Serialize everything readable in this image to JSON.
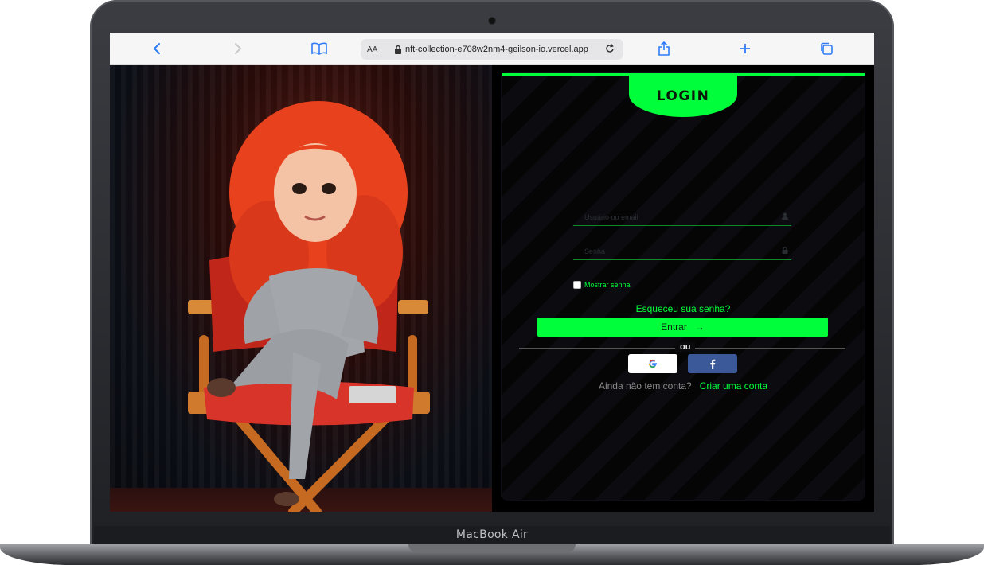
{
  "device": {
    "label": "MacBook Air"
  },
  "browser": {
    "text_size_label": "AA",
    "url": "nft-collection-e708w2nm4-geilson-io.vercel.app"
  },
  "login": {
    "title": "LOGIN",
    "user_placeholder": "Usuário ou email",
    "password_placeholder": "Senha",
    "show_password_label": "Mostrar senha",
    "forgot_link": "Esqueceu sua senha?",
    "submit_label": "Entrar",
    "submit_arrow": "→",
    "divider_label": "ou",
    "no_account_text": "Ainda não tem conta?",
    "create_account_link": "Criar uma conta"
  },
  "colors": {
    "accent": "#00ff3a",
    "facebook": "#3b5998"
  },
  "icons": {
    "back": "chevron-left-icon",
    "forward": "chevron-right-icon",
    "bookmarks": "book-icon",
    "reload": "reload-icon",
    "share": "share-icon",
    "new_tab": "plus-icon",
    "tabs": "tabs-icon",
    "google": "google-icon",
    "facebook": "facebook-icon"
  }
}
